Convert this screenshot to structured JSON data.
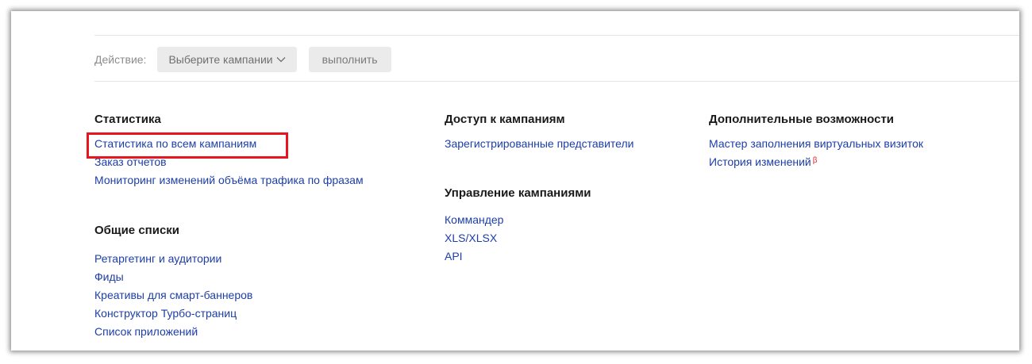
{
  "action_bar": {
    "label": "Действие:",
    "select_value": "Выберите кампании",
    "execute_label": "выполнить"
  },
  "statistics": {
    "title": "Статистика",
    "links": [
      "Статистика по всем кампаниям",
      "Заказ отчетов",
      "Мониторинг изменений объёма трафика по фразам"
    ]
  },
  "shared_lists": {
    "title": "Общие списки",
    "links": [
      "Ретаргетинг и аудитории",
      "Фиды",
      "Креативы для смарт-баннеров",
      "Конструктор Турбо-страниц",
      "Список приложений"
    ]
  },
  "campaign_access": {
    "title": "Доступ к кампаниям",
    "links": [
      "Зарегистрированные представители"
    ]
  },
  "campaign_management": {
    "title": "Управление кампаниями",
    "links": [
      "Коммандер",
      "XLS/XLSX",
      "API"
    ]
  },
  "extra_features": {
    "title": "Дополнительные возможности",
    "links": [
      "Мастер заполнения виртуальных визиток",
      "История изменений"
    ],
    "beta_badge": "β"
  },
  "colors": {
    "link": "#1d3ea8",
    "highlight": "#e8141e"
  }
}
